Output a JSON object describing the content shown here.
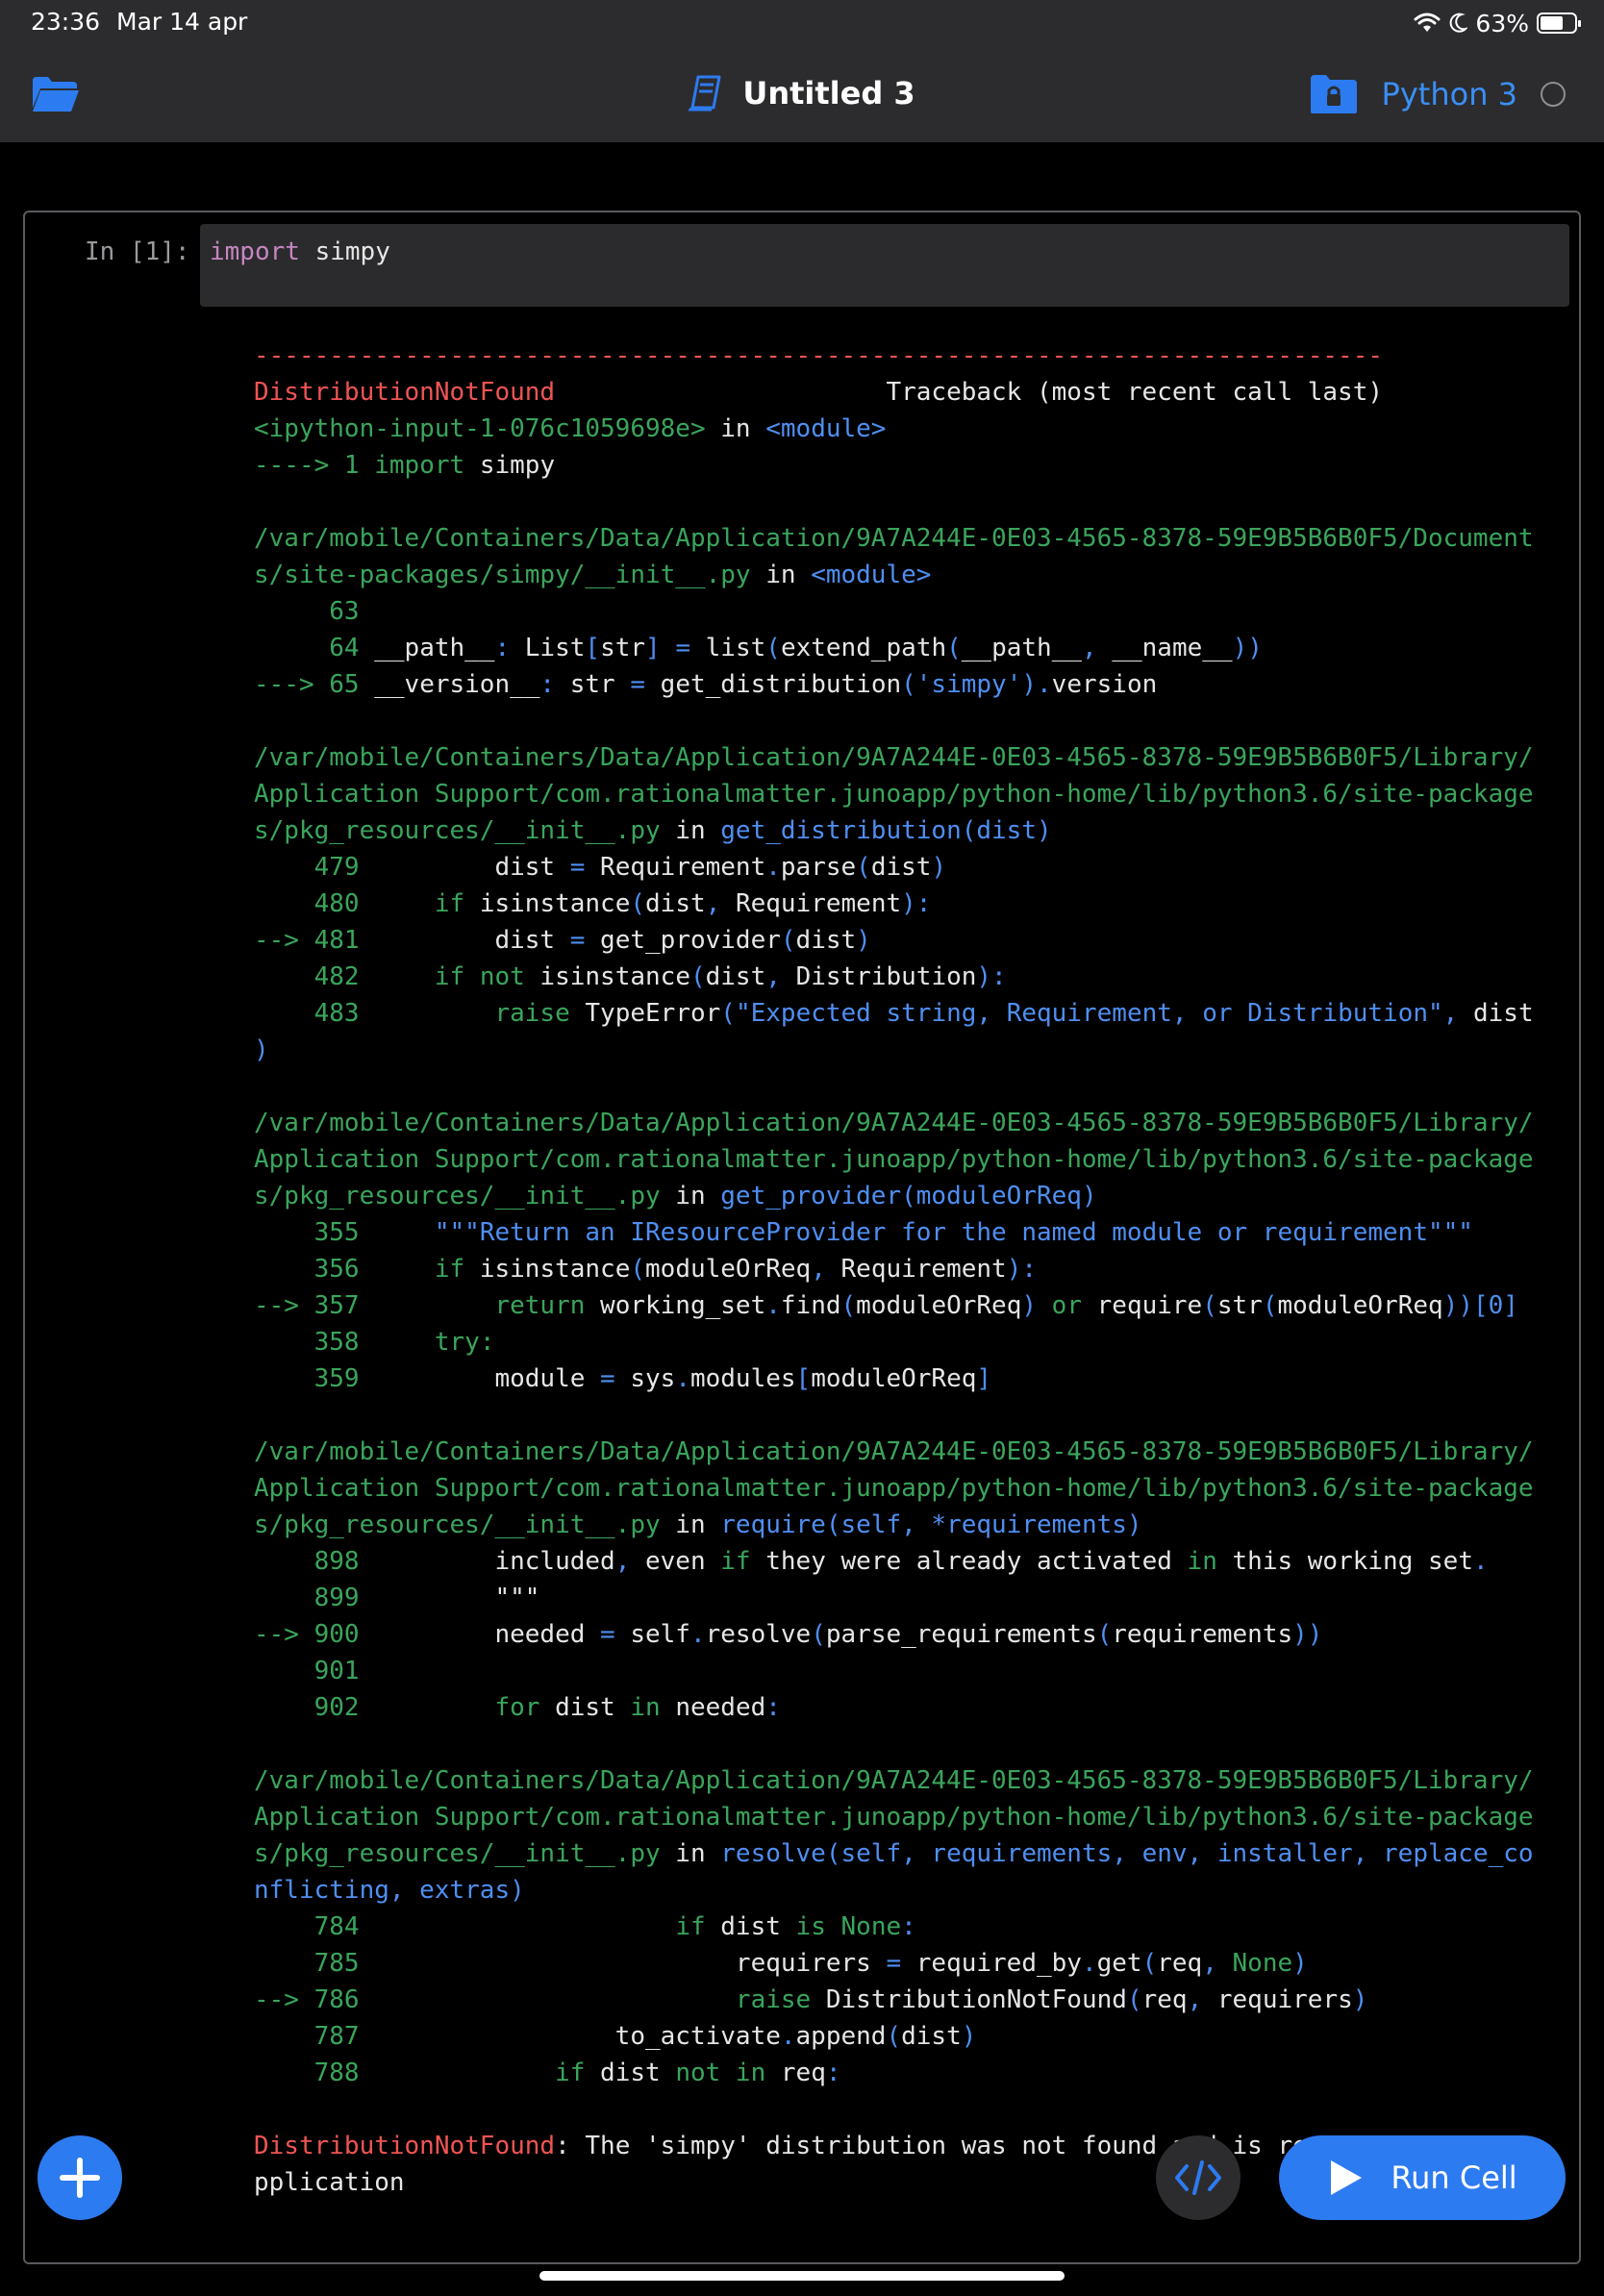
{
  "status_bar": {
    "time": "23:36",
    "date": "Mar 14 apr",
    "battery": "63%"
  },
  "toolbar": {
    "title": "Untitled 3",
    "kernel": "Python 3"
  },
  "cell": {
    "prompt": "In [1]:",
    "code": "import simpy",
    "output_lines": [
      [
        {
          "t": "---------------------------------------------------------------------------",
          "c": "r"
        }
      ],
      [
        {
          "t": "DistributionNotFound",
          "c": "r"
        },
        {
          "t": "                      Traceback (most recent call last)",
          "c": "w"
        }
      ],
      [
        {
          "t": "<ipython-input-1-076c1059698e>",
          "c": "g"
        },
        {
          "t": " in ",
          "c": "w"
        },
        {
          "t": "<module>",
          "c": "b"
        }
      ],
      [
        {
          "t": "---->",
          "c": "g"
        },
        {
          "t": " 1 ",
          "c": "g"
        },
        {
          "t": "import",
          "c": "kw"
        },
        {
          "t": " simpy",
          "c": "w"
        }
      ],
      [
        {
          "t": "",
          "c": "w"
        }
      ],
      [
        {
          "t": "/var/mobile/Containers/Data/Application/9A7A244E-0E03-4565-8378-59E9B5B6B0F5/Document",
          "c": "g"
        }
      ],
      [
        {
          "t": "s/site-packages/simpy/__init__.py",
          "c": "g"
        },
        {
          "t": " in ",
          "c": "w"
        },
        {
          "t": "<module>",
          "c": "b"
        }
      ],
      [
        {
          "t": "     63",
          "c": "g"
        }
      ],
      [
        {
          "t": "     64",
          "c": "g"
        },
        {
          "t": " __path__",
          "c": "w"
        },
        {
          "t": ":",
          "c": "b"
        },
        {
          "t": " List",
          "c": "w"
        },
        {
          "t": "[",
          "c": "b"
        },
        {
          "t": "str",
          "c": "w"
        },
        {
          "t": "]",
          "c": "b"
        },
        {
          "t": " = ",
          "c": "b"
        },
        {
          "t": "list",
          "c": "w"
        },
        {
          "t": "(",
          "c": "b"
        },
        {
          "t": "extend_path",
          "c": "w"
        },
        {
          "t": "(",
          "c": "b"
        },
        {
          "t": "__path__",
          "c": "w"
        },
        {
          "t": ", ",
          "c": "b"
        },
        {
          "t": "__name__",
          "c": "w"
        },
        {
          "t": "))",
          "c": "b"
        }
      ],
      [
        {
          "t": "---> 65",
          "c": "g"
        },
        {
          "t": " __version__",
          "c": "w"
        },
        {
          "t": ":",
          "c": "b"
        },
        {
          "t": " str ",
          "c": "w"
        },
        {
          "t": "= ",
          "c": "b"
        },
        {
          "t": "get_distribution",
          "c": "w"
        },
        {
          "t": "(",
          "c": "b"
        },
        {
          "t": "'simpy'",
          "c": "b"
        },
        {
          "t": ").",
          "c": "b"
        },
        {
          "t": "version",
          "c": "w"
        }
      ],
      [
        {
          "t": "",
          "c": "w"
        }
      ],
      [
        {
          "t": "/var/mobile/Containers/Data/Application/9A7A244E-0E03-4565-8378-59E9B5B6B0F5/Library/",
          "c": "g"
        }
      ],
      [
        {
          "t": "Application Support/com.rationalmatter.junoapp/python-home/lib/python3.6/site-package",
          "c": "g"
        }
      ],
      [
        {
          "t": "s/pkg_resources/__init__.py",
          "c": "g"
        },
        {
          "t": " in ",
          "c": "w"
        },
        {
          "t": "get_distribution",
          "c": "b"
        },
        {
          "t": "(dist)",
          "c": "b"
        }
      ],
      [
        {
          "t": "    479",
          "c": "g"
        },
        {
          "t": "         dist ",
          "c": "w"
        },
        {
          "t": "= ",
          "c": "b"
        },
        {
          "t": "Requirement",
          "c": "w"
        },
        {
          "t": ".",
          "c": "b"
        },
        {
          "t": "parse",
          "c": "w"
        },
        {
          "t": "(",
          "c": "b"
        },
        {
          "t": "dist",
          "c": "w"
        },
        {
          "t": ")",
          "c": "b"
        }
      ],
      [
        {
          "t": "    480",
          "c": "g"
        },
        {
          "t": "     ",
          "c": "w"
        },
        {
          "t": "if",
          "c": "kw"
        },
        {
          "t": " isinstance",
          "c": "w"
        },
        {
          "t": "(",
          "c": "b"
        },
        {
          "t": "dist",
          "c": "w"
        },
        {
          "t": ", ",
          "c": "b"
        },
        {
          "t": "Requirement",
          "c": "w"
        },
        {
          "t": "):",
          "c": "b"
        }
      ],
      [
        {
          "t": "--> 481",
          "c": "g"
        },
        {
          "t": "         dist ",
          "c": "w"
        },
        {
          "t": "= ",
          "c": "b"
        },
        {
          "t": "get_provider",
          "c": "w"
        },
        {
          "t": "(",
          "c": "b"
        },
        {
          "t": "dist",
          "c": "w"
        },
        {
          "t": ")",
          "c": "b"
        }
      ],
      [
        {
          "t": "    482",
          "c": "g"
        },
        {
          "t": "     ",
          "c": "w"
        },
        {
          "t": "if not",
          "c": "kw"
        },
        {
          "t": " isinstance",
          "c": "w"
        },
        {
          "t": "(",
          "c": "b"
        },
        {
          "t": "dist",
          "c": "w"
        },
        {
          "t": ", ",
          "c": "b"
        },
        {
          "t": "Distribution",
          "c": "w"
        },
        {
          "t": "):",
          "c": "b"
        }
      ],
      [
        {
          "t": "    483",
          "c": "g"
        },
        {
          "t": "         ",
          "c": "w"
        },
        {
          "t": "raise",
          "c": "kw"
        },
        {
          "t": " TypeError",
          "c": "w"
        },
        {
          "t": "(",
          "c": "b"
        },
        {
          "t": "\"Expected string, Requirement, or Distribution\"",
          "c": "b"
        },
        {
          "t": ", ",
          "c": "b"
        },
        {
          "t": "dist",
          "c": "w"
        }
      ],
      [
        {
          "t": ")",
          "c": "b"
        }
      ],
      [
        {
          "t": "",
          "c": "w"
        }
      ],
      [
        {
          "t": "/var/mobile/Containers/Data/Application/9A7A244E-0E03-4565-8378-59E9B5B6B0F5/Library/",
          "c": "g"
        }
      ],
      [
        {
          "t": "Application Support/com.rationalmatter.junoapp/python-home/lib/python3.6/site-package",
          "c": "g"
        }
      ],
      [
        {
          "t": "s/pkg_resources/__init__.py",
          "c": "g"
        },
        {
          "t": " in ",
          "c": "w"
        },
        {
          "t": "get_provider",
          "c": "b"
        },
        {
          "t": "(moduleOrReq)",
          "c": "b"
        }
      ],
      [
        {
          "t": "    355",
          "c": "g"
        },
        {
          "t": "     ",
          "c": "w"
        },
        {
          "t": "\"\"\"Return an IResourceProvider for the named module or requirement\"\"\"",
          "c": "b"
        }
      ],
      [
        {
          "t": "    356",
          "c": "g"
        },
        {
          "t": "     ",
          "c": "w"
        },
        {
          "t": "if",
          "c": "kw"
        },
        {
          "t": " isinstance",
          "c": "w"
        },
        {
          "t": "(",
          "c": "b"
        },
        {
          "t": "moduleOrReq",
          "c": "w"
        },
        {
          "t": ", ",
          "c": "b"
        },
        {
          "t": "Requirement",
          "c": "w"
        },
        {
          "t": "):",
          "c": "b"
        }
      ],
      [
        {
          "t": "--> 357",
          "c": "g"
        },
        {
          "t": "         ",
          "c": "w"
        },
        {
          "t": "return",
          "c": "kw"
        },
        {
          "t": " working_set",
          "c": "w"
        },
        {
          "t": ".",
          "c": "b"
        },
        {
          "t": "find",
          "c": "w"
        },
        {
          "t": "(",
          "c": "b"
        },
        {
          "t": "moduleOrReq",
          "c": "w"
        },
        {
          "t": ") ",
          "c": "b"
        },
        {
          "t": "or",
          "c": "kw"
        },
        {
          "t": " require",
          "c": "w"
        },
        {
          "t": "(",
          "c": "b"
        },
        {
          "t": "str",
          "c": "w"
        },
        {
          "t": "(",
          "c": "b"
        },
        {
          "t": "moduleOrReq",
          "c": "w"
        },
        {
          "t": "))[0]",
          "c": "b"
        }
      ],
      [
        {
          "t": "    358",
          "c": "g"
        },
        {
          "t": "     ",
          "c": "w"
        },
        {
          "t": "try:",
          "c": "kw"
        }
      ],
      [
        {
          "t": "    359",
          "c": "g"
        },
        {
          "t": "         module ",
          "c": "w"
        },
        {
          "t": "= ",
          "c": "b"
        },
        {
          "t": "sys",
          "c": "w"
        },
        {
          "t": ".",
          "c": "b"
        },
        {
          "t": "modules",
          "c": "w"
        },
        {
          "t": "[",
          "c": "b"
        },
        {
          "t": "moduleOrReq",
          "c": "w"
        },
        {
          "t": "]",
          "c": "b"
        }
      ],
      [
        {
          "t": "",
          "c": "w"
        }
      ],
      [
        {
          "t": "/var/mobile/Containers/Data/Application/9A7A244E-0E03-4565-8378-59E9B5B6B0F5/Library/",
          "c": "g"
        }
      ],
      [
        {
          "t": "Application Support/com.rationalmatter.junoapp/python-home/lib/python3.6/site-package",
          "c": "g"
        }
      ],
      [
        {
          "t": "s/pkg_resources/__init__.py",
          "c": "g"
        },
        {
          "t": " in ",
          "c": "w"
        },
        {
          "t": "require",
          "c": "b"
        },
        {
          "t": "(self, *requirements)",
          "c": "b"
        }
      ],
      [
        {
          "t": "    898",
          "c": "g"
        },
        {
          "t": "         included",
          "c": "w"
        },
        {
          "t": ", ",
          "c": "b"
        },
        {
          "t": "even ",
          "c": "w"
        },
        {
          "t": "if",
          "c": "kw"
        },
        {
          "t": " they were already activated ",
          "c": "w"
        },
        {
          "t": "in",
          "c": "kw"
        },
        {
          "t": " this working set",
          "c": "w"
        },
        {
          "t": ".",
          "c": "b"
        }
      ],
      [
        {
          "t": "    899",
          "c": "g"
        },
        {
          "t": "         \"\"\"",
          "c": "w"
        }
      ],
      [
        {
          "t": "--> 900",
          "c": "g"
        },
        {
          "t": "         needed ",
          "c": "w"
        },
        {
          "t": "= ",
          "c": "b"
        },
        {
          "t": "self",
          "c": "w"
        },
        {
          "t": ".",
          "c": "b"
        },
        {
          "t": "resolve",
          "c": "w"
        },
        {
          "t": "(",
          "c": "b"
        },
        {
          "t": "parse_requirements",
          "c": "w"
        },
        {
          "t": "(",
          "c": "b"
        },
        {
          "t": "requirements",
          "c": "w"
        },
        {
          "t": "))",
          "c": "b"
        }
      ],
      [
        {
          "t": "    901",
          "c": "g"
        }
      ],
      [
        {
          "t": "    902",
          "c": "g"
        },
        {
          "t": "         ",
          "c": "w"
        },
        {
          "t": "for",
          "c": "kw"
        },
        {
          "t": " dist ",
          "c": "w"
        },
        {
          "t": "in",
          "c": "kw"
        },
        {
          "t": " needed",
          "c": "w"
        },
        {
          "t": ":",
          "c": "b"
        }
      ],
      [
        {
          "t": "",
          "c": "w"
        }
      ],
      [
        {
          "t": "/var/mobile/Containers/Data/Application/9A7A244E-0E03-4565-8378-59E9B5B6B0F5/Library/",
          "c": "g"
        }
      ],
      [
        {
          "t": "Application Support/com.rationalmatter.junoapp/python-home/lib/python3.6/site-package",
          "c": "g"
        }
      ],
      [
        {
          "t": "s/pkg_resources/__init__.py",
          "c": "g"
        },
        {
          "t": " in ",
          "c": "w"
        },
        {
          "t": "resolve",
          "c": "b"
        },
        {
          "t": "(self, requirements, env, installer, replace_co",
          "c": "b"
        }
      ],
      [
        {
          "t": "nflicting, extras)",
          "c": "b"
        }
      ],
      [
        {
          "t": "    784",
          "c": "g"
        },
        {
          "t": "                     ",
          "c": "w"
        },
        {
          "t": "if",
          "c": "kw"
        },
        {
          "t": " dist ",
          "c": "w"
        },
        {
          "t": "is None",
          "c": "kw"
        },
        {
          "t": ":",
          "c": "b"
        }
      ],
      [
        {
          "t": "    785",
          "c": "g"
        },
        {
          "t": "                         requirers ",
          "c": "w"
        },
        {
          "t": "= ",
          "c": "b"
        },
        {
          "t": "required_by",
          "c": "w"
        },
        {
          "t": ".",
          "c": "b"
        },
        {
          "t": "get",
          "c": "w"
        },
        {
          "t": "(",
          "c": "b"
        },
        {
          "t": "req",
          "c": "w"
        },
        {
          "t": ", ",
          "c": "b"
        },
        {
          "t": "None",
          "c": "kw"
        },
        {
          "t": ")",
          "c": "b"
        }
      ],
      [
        {
          "t": "--> 786",
          "c": "g"
        },
        {
          "t": "                         ",
          "c": "w"
        },
        {
          "t": "raise",
          "c": "kw"
        },
        {
          "t": " DistributionNotFound",
          "c": "w"
        },
        {
          "t": "(",
          "c": "b"
        },
        {
          "t": "req",
          "c": "w"
        },
        {
          "t": ", ",
          "c": "b"
        },
        {
          "t": "requirers",
          "c": "w"
        },
        {
          "t": ")",
          "c": "b"
        }
      ],
      [
        {
          "t": "    787",
          "c": "g"
        },
        {
          "t": "                 to_activate",
          "c": "w"
        },
        {
          "t": ".",
          "c": "b"
        },
        {
          "t": "append",
          "c": "w"
        },
        {
          "t": "(",
          "c": "b"
        },
        {
          "t": "dist",
          "c": "w"
        },
        {
          "t": ")",
          "c": "b"
        }
      ],
      [
        {
          "t": "    788",
          "c": "g"
        },
        {
          "t": "             ",
          "c": "w"
        },
        {
          "t": "if",
          "c": "kw"
        },
        {
          "t": " dist ",
          "c": "w"
        },
        {
          "t": "not in",
          "c": "kw"
        },
        {
          "t": " req",
          "c": "w"
        },
        {
          "t": ":",
          "c": "b"
        }
      ],
      [
        {
          "t": "",
          "c": "w"
        }
      ],
      [
        {
          "t": "DistributionNotFound",
          "c": "r"
        },
        {
          "t": ": The 'simpy' distribution was not found and is re",
          "c": "w"
        }
      ],
      [
        {
          "t": "pplication",
          "c": "w"
        }
      ]
    ]
  },
  "actions": {
    "run_cell": "Run Cell"
  },
  "colors": {
    "accent": "#2d7bf0",
    "kernel_label": "#3a8ff5",
    "traceback_green": "#3aa55c",
    "traceback_red": "#f05454",
    "traceback_blue": "#4f8ff2"
  }
}
